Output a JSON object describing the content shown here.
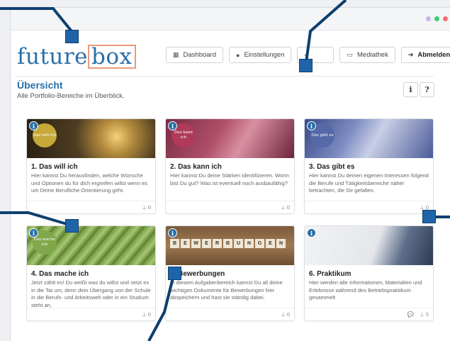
{
  "app": {
    "logo_left": "future",
    "logo_box": "box"
  },
  "nav": [
    {
      "label": "Dashboard",
      "icon": "grid-icon"
    },
    {
      "label": "Einstellungen",
      "icon": "user-icon"
    },
    {
      "label": "",
      "icon": "share-icon"
    },
    {
      "label": "Mediathek",
      "icon": "media-icon"
    },
    {
      "label": "Abmelden",
      "icon": "logout-icon"
    }
  ],
  "page": {
    "title": "Übersicht",
    "subtitle": "Alle Portfolio-Bereiche im Überblick.",
    "info_label": "i",
    "help_label": "?"
  },
  "cards": [
    {
      "title": "1. Das will ich",
      "badge": "Das will ich",
      "badge_color": "#c7a93a",
      "text": "Hier kannst Du herausfinden, welche Wünsche und Optionen du für dich ergreifen willst wenn es um Deine Berufliche Orientierung geht.",
      "pins": "0",
      "comments": ""
    },
    {
      "title": "2. Das kann ich",
      "badge": "Das kann ich",
      "badge_color": "#b03a5b",
      "text": "Hier kannst Du deine Stärken identifizieren. Worin bist Du gut? Was ist eventuell noch ausbaufähig?",
      "pins": "0",
      "comments": ""
    },
    {
      "title": "3. Das gibt es",
      "badge": "Das gibt es",
      "badge_color": "#5568a8",
      "text": "Hier kannst Du deinen eigenen Interessen folgend die Berufe und Tätigkeitsbereiche näher betrachten, die Dir gefallen.",
      "pins": "0",
      "comments": ""
    },
    {
      "title": "4. Das mache ich",
      "badge": "Das mache ich",
      "badge_color": "#7fa84a",
      "text": "Jetzt zählt es! Du weißt was du willst und setzt es in die Tat um, denn dein Übergang von der Schule in die Berufs- und Arbeitswelt oder in ein Studium steht an.",
      "pins": "0",
      "comments": ""
    },
    {
      "title": "5. Bewerbungen",
      "badge": "",
      "badge_color": "",
      "text": "In diesem Aufgabenbereich kannst Du all deine wichtigen Dokumente für Bewerbungen hier abspeichern und hast sie ständig dabei.",
      "pins": "0",
      "comments": ""
    },
    {
      "title": "6. Praktikum",
      "badge": "",
      "badge_color": "",
      "text": "Hier werden alle Informationen, Materialien und Erlebnisse während des Betriebspraktikum gesammelt",
      "pins": "5",
      "comments": "💬"
    }
  ],
  "colors": {
    "accent": "#2a6fa8",
    "marker": "#1f64a8"
  },
  "icons": {
    "pin": "pin-icon",
    "info": "info-icon",
    "comment": "comment-icon"
  }
}
